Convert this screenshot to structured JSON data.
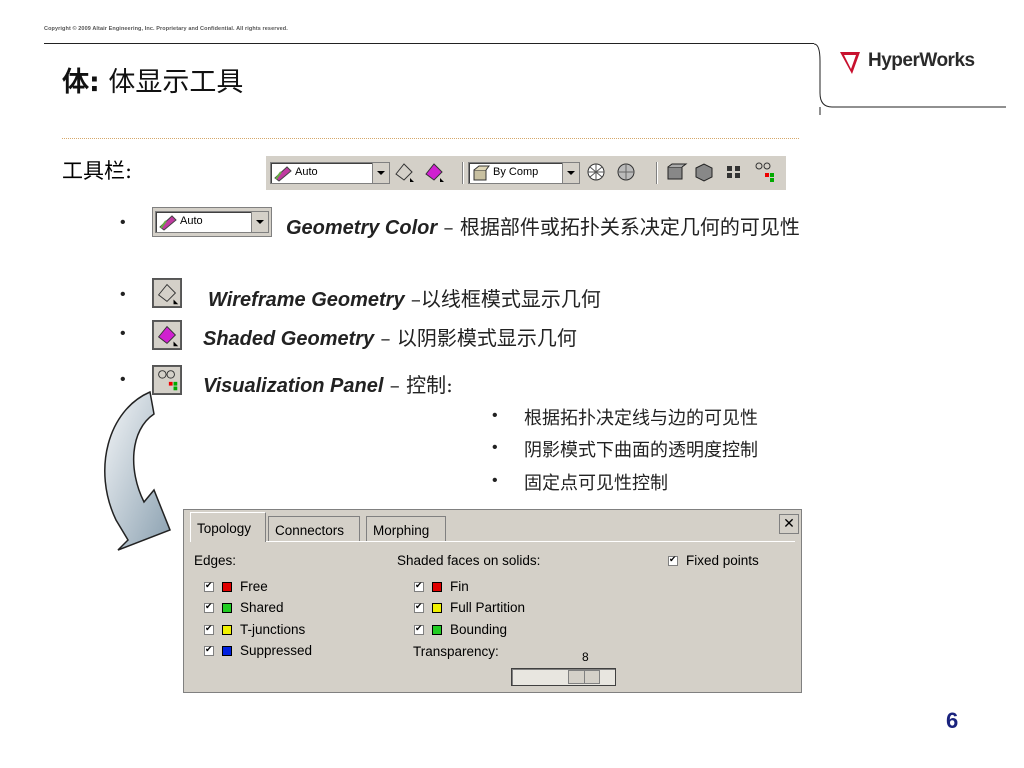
{
  "header": {
    "copyright": "Copyright © 2009 Altair Engineering, Inc. Proprietary and Confidential. All rights reserved.",
    "brand": "HyperWorks",
    "title_bold": "体:",
    "title_rest": " 体显示工具"
  },
  "toolbar": {
    "label": "工具栏:",
    "color_combo": "Auto",
    "comp_combo": "By Comp"
  },
  "items": [
    {
      "combo": "Auto",
      "name": "Geometry Color",
      "desc": " – 根据部件或拓扑关系决定几何的可见性"
    },
    {
      "name": "Wireframe Geometry",
      "desc": " –以线框模式显示几何"
    },
    {
      "name": "Shaded Geometry",
      "desc": " – 以阴影模式显示几何"
    },
    {
      "name": "Visualization Panel",
      "desc": " – 控制:"
    }
  ],
  "sub_items": [
    "根据拓扑决定线与边的可见性",
    "阴影模式下曲面的透明度控制",
    "固定点可见性控制"
  ],
  "panel": {
    "tabs": [
      "Topology",
      "Connectors",
      "Morphing"
    ],
    "edges_label": "Edges:",
    "edges": [
      {
        "label": "Free",
        "color": "#e00000"
      },
      {
        "label": "Shared",
        "color": "#22cc22"
      },
      {
        "label": "T-junctions",
        "color": "#f0f000"
      },
      {
        "label": "Suppressed",
        "color": "#0020e0"
      }
    ],
    "faces_label": "Shaded faces on solids:",
    "faces": [
      {
        "label": "Fin",
        "color": "#e00000"
      },
      {
        "label": "Full Partition",
        "color": "#f0f000"
      },
      {
        "label": "Bounding",
        "color": "#22cc22"
      }
    ],
    "transparency_label": "Transparency:",
    "transparency_value": "8",
    "fixed_points": "Fixed points"
  },
  "page_number": "6",
  "colors": {
    "accent_navy": "#1a237e",
    "logo_red": "#c8102e"
  }
}
